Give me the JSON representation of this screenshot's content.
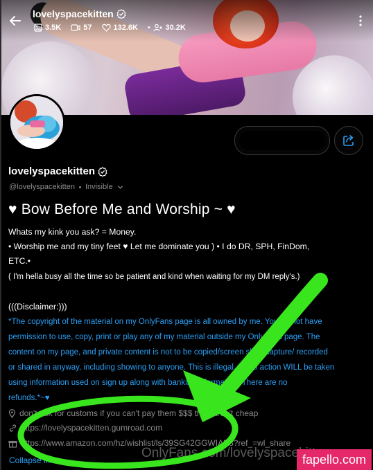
{
  "profile": {
    "display_name": "lovelyspacekitten",
    "handle": "@lovelyspacekitten",
    "status": "Invisible",
    "stats": {
      "photos": "3.5K",
      "videos": "57",
      "likes": "132.6K",
      "fans": "30.2K"
    }
  },
  "about": {
    "headline": "♥ Bow Before Me and Worship ~ ♥",
    "line1": "Whats my kink you ask? = Money.",
    "line2": "• Worship me and my tiny feet ♥ Let me dominate you ) • I do DR, SPH, FinDom,",
    "line3": "ETC.•",
    "line4": "( I'm hella busy all the time so be patient and kind when waiting for my DM reply's.)",
    "disclaimer_title": "(((Disclaimer:)))",
    "disclaimer": [
      "*The copyright of the material on my OnlyFans page is all owned by me. You do not have",
      "permission to use, copy, print or play any of my material outside my OnlyFans page. The",
      "content on my page, and private content is not to be copied/screen shot/ capture/ recorded",
      "or shared in anyway, including showing to anyone. This is illegal. Legal action WILL be taken",
      "using information used on sign up along with banking information. There are no",
      "refunds.*~♥"
    ],
    "location": "don't ask for customs if you can't pay them $$$ they aren't cheap",
    "link1": "https://lovelyspacekitten.gumroad.com",
    "link2": "https://www.amazon.com/hz/wishlist/ls/39SG42GGWIAP8?ref_=wl_share",
    "collapse_label": "Collapse info"
  },
  "watermarks": {
    "site": "OnlyFans.com/lovelyspacekitten",
    "badge": "fapello.com"
  },
  "colors": {
    "accent": "#2a9ff4",
    "muted": "#8a8a8a",
    "annotation": "#39e61e",
    "badge": "#e4286a"
  }
}
